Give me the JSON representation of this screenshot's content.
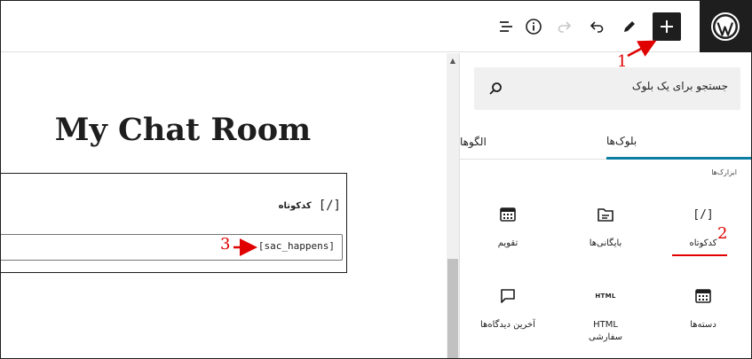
{
  "toolbar": {
    "add_block": "add-block",
    "edit": "pencil",
    "undo": "undo",
    "redo": "redo",
    "details": "info",
    "outline": "list-view"
  },
  "editor": {
    "title": "My Chat Room",
    "shortcode_block": {
      "icon": "[/]",
      "label": "کدکوتاه",
      "value": "[sac_happens]"
    }
  },
  "inserter": {
    "search_placeholder": "جستجو برای یک بلوک",
    "tabs": [
      {
        "label": "بلوک‌ها",
        "active": true
      },
      {
        "label": "الگوها",
        "active": false
      }
    ],
    "category": "ابزارک‌ها",
    "items": [
      {
        "label": "کدکوتاه",
        "icon": "shortcode-icon",
        "glyph": "[/]"
      },
      {
        "label": "بایگانی‌ها",
        "icon": "archive-icon",
        "glyph": ""
      },
      {
        "label": "تقویم",
        "icon": "calendar-icon",
        "glyph": ""
      },
      {
        "label": "دسته‌ها",
        "icon": "categories-icon",
        "glyph": ""
      },
      {
        "label": "HTML\nسفارشی",
        "icon": "html-icon",
        "glyph": "HTML"
      },
      {
        "label": "آخرین دیدگاه‌ها",
        "icon": "comments-icon",
        "glyph": ""
      }
    ]
  },
  "annotations": [
    "1",
    "2",
    "3"
  ],
  "colors": {
    "dark": "#1e1e1e",
    "accent": "#0a7ea3",
    "annotation": "#e00000"
  }
}
